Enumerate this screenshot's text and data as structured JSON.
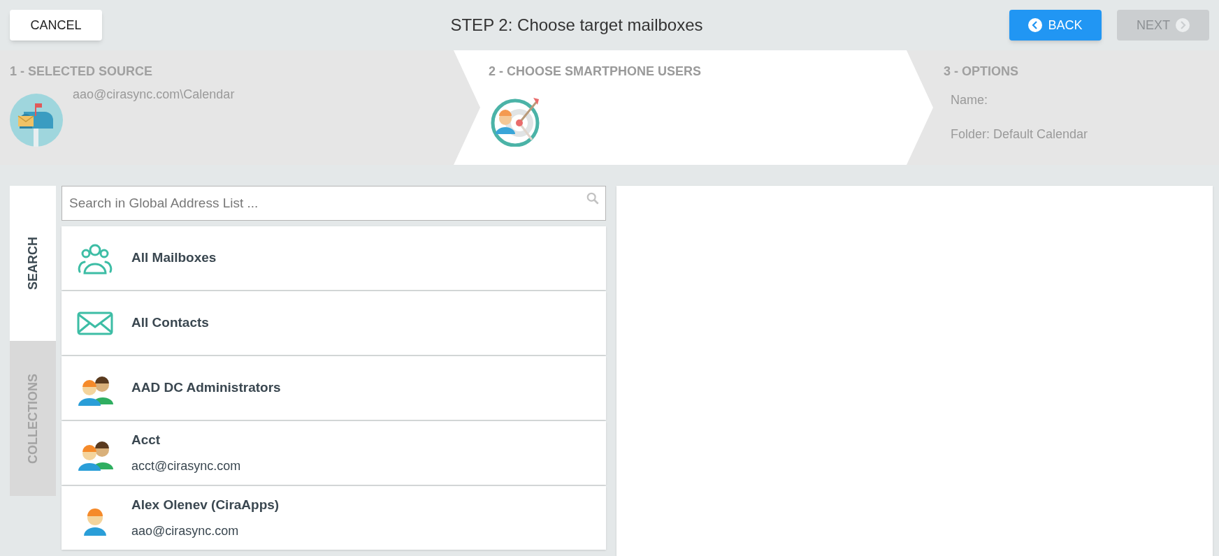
{
  "header": {
    "cancel": "CANCEL",
    "title": "STEP 2: Choose target mailboxes",
    "back": {
      "label": "BACK",
      "disabled": false
    },
    "next": {
      "label": "NEXT",
      "disabled": true
    }
  },
  "steps": [
    {
      "title": "1 - SELECTED SOURCE",
      "selected": false,
      "kind": "mailbox",
      "lines": [
        "aao@cirasync.com\\Calendar"
      ]
    },
    {
      "title": "2 - CHOOSE SMARTPHONE USERS",
      "selected": true,
      "kind": "target"
    },
    {
      "title": "3 - OPTIONS",
      "selected": false,
      "kind": "options",
      "lines": [
        "Name:",
        "Folder: Default Calendar"
      ]
    }
  ],
  "side_tabs": [
    {
      "label": "SEARCH",
      "selected": true
    },
    {
      "label": "COLLECTIONS",
      "selected": false
    }
  ],
  "search": {
    "placeholder": "Search in Global Address List ..."
  },
  "list": [
    {
      "kind": "mailboxes",
      "name": "All Mailboxes"
    },
    {
      "kind": "contacts",
      "name": "All Contacts"
    },
    {
      "kind": "group",
      "name": "AAD DC Administrators"
    },
    {
      "kind": "group",
      "name": "Acct",
      "email": "acct@cirasync.com"
    },
    {
      "kind": "user",
      "name": "Alex Olenev (CiraApps)",
      "email": "aao@cirasync.com"
    }
  ]
}
